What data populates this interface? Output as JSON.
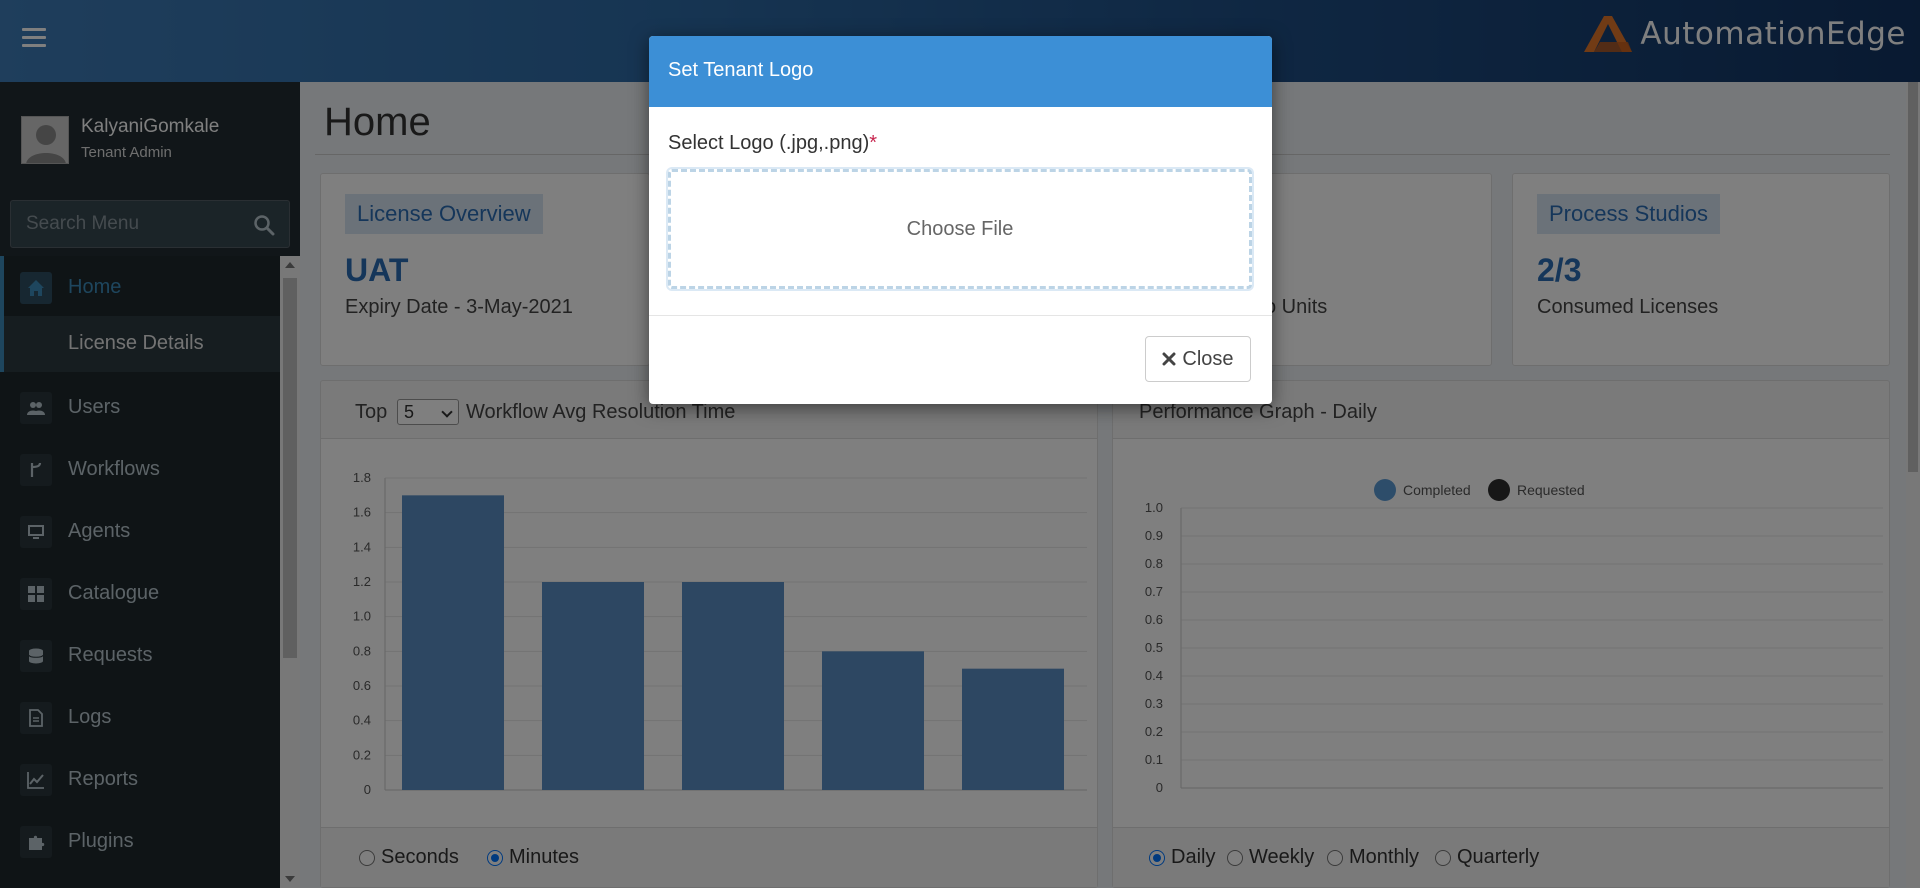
{
  "header": {
    "menu_toggle_icon": "hamburger-icon",
    "brand": "AutomationEdge",
    "brand_colors": {
      "logo_mark": "#e2762b",
      "text": "#ffffff"
    }
  },
  "sidebar": {
    "user": {
      "name": "KalyaniGomkale",
      "role": "Tenant Admin"
    },
    "search": {
      "placeholder": "Search Menu",
      "icon": "search-icon"
    },
    "items": [
      {
        "label": "Home",
        "icon": "home-icon",
        "active": true
      },
      {
        "label": "License Details",
        "submenu": true
      },
      {
        "label": "Users",
        "icon": "users-icon"
      },
      {
        "label": "Workflows",
        "icon": "workflow-icon"
      },
      {
        "label": "Agents",
        "icon": "monitor-icon"
      },
      {
        "label": "Catalogue",
        "icon": "grid-icon"
      },
      {
        "label": "Requests",
        "icon": "database-icon"
      },
      {
        "label": "Logs",
        "icon": "file-icon"
      },
      {
        "label": "Reports",
        "icon": "line-chart-icon"
      },
      {
        "label": "Plugins",
        "icon": "puzzle-icon"
      }
    ]
  },
  "main": {
    "title": "Home",
    "cards": [
      {
        "tag": "License Overview",
        "value": "UAT",
        "sub": "Expiry Date - 3-May-2021"
      },
      {
        "tag": "",
        "value": "",
        "sub": "o Units"
      },
      {
        "tag": "Process Studios",
        "value": "2/3",
        "sub": "Consumed Licenses"
      }
    ],
    "left_panel": {
      "top_label": "Top",
      "top_value": "5",
      "title": "Workflow Avg Resolution Time",
      "units": [
        "Seconds",
        "Minutes"
      ],
      "selected_unit": "Minutes"
    },
    "right_panel": {
      "title": "Performance Graph - Daily",
      "periods": [
        "Daily",
        "Weekly",
        "Monthly",
        "Quarterly"
      ],
      "selected_period": "Daily"
    }
  },
  "chart_data": [
    {
      "type": "bar",
      "categories": [
        "",
        "",
        "",
        "",
        ""
      ],
      "values": [
        1.7,
        1.2,
        1.2,
        0.8,
        0.7
      ],
      "yticks": [
        "0",
        "0.2",
        "0.4",
        "0.6",
        "0.8",
        "1.0",
        "1.2",
        "1.4",
        "1.6",
        "1.8"
      ],
      "ylim": [
        0,
        1.8
      ],
      "color": "#5b8fc5",
      "grid": true
    },
    {
      "type": "line",
      "series": [
        {
          "name": "Completed",
          "values": [],
          "color": "#5b9bd5"
        },
        {
          "name": "Requested",
          "values": [],
          "color": "#2e2e2e"
        }
      ],
      "yticks": [
        "0",
        "0.1",
        "0.2",
        "0.3",
        "0.4",
        "0.5",
        "0.6",
        "0.7",
        "0.8",
        "0.9",
        "1.0"
      ],
      "ylim": [
        0,
        1.0
      ],
      "legend": "top-center",
      "grid": true
    }
  ],
  "modal": {
    "title": "Set Tenant Logo",
    "field_label": "Select Logo (.jpg,.png)",
    "required_mark": "*",
    "dropzone_text": "Choose File",
    "close_label": "Close",
    "close_icon": "close-icon"
  }
}
